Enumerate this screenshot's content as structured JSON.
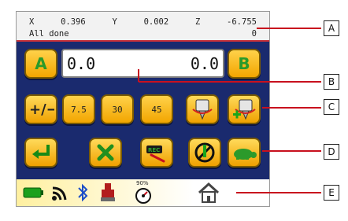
{
  "status": {
    "x_label": "X",
    "x_value": "0.396",
    "y_label": "Y",
    "y_value": "0.002",
    "z_label": "Z",
    "z_value": "-6.755",
    "message": "All done",
    "count": "0"
  },
  "top_row": {
    "a_label": "A",
    "b_label": "B",
    "value_left": "0.0",
    "value_right": "0.0"
  },
  "middle_row": {
    "angle_buttons": [
      "7.5",
      "30",
      "45"
    ]
  },
  "bottom_row": {
    "rec_label": "REC"
  },
  "footer": {
    "percent": "90%"
  },
  "callouts": [
    "A",
    "B",
    "C",
    "D",
    "E"
  ]
}
